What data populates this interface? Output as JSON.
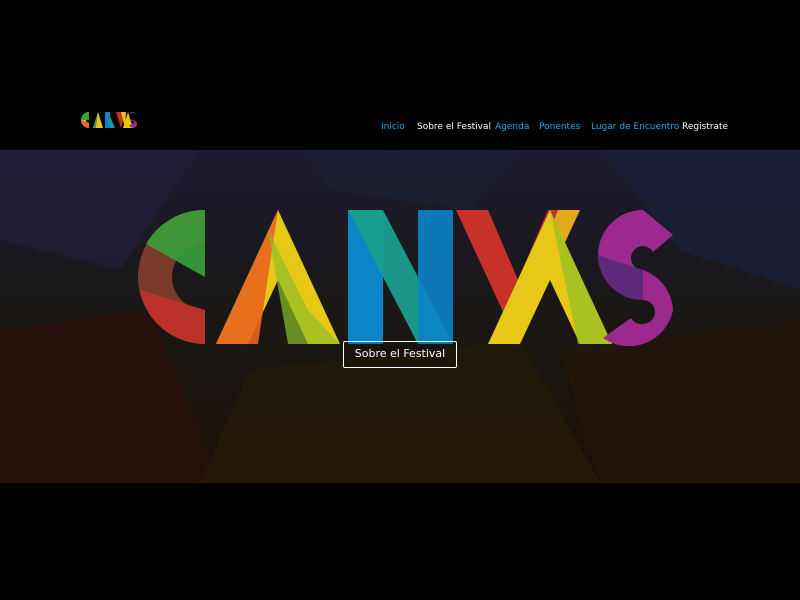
{
  "header": {
    "logo_text": "CANVAS"
  },
  "nav": {
    "items": [
      {
        "label": "Inicio",
        "state": "link"
      },
      {
        "label": "Sobre el Festival",
        "state": "current"
      },
      {
        "label": "Agenda",
        "state": "link"
      },
      {
        "label": "Ponentes",
        "state": "link"
      },
      {
        "label": "Lugar de Encuentro",
        "state": "link"
      },
      {
        "label": "Registrate",
        "state": "current"
      }
    ],
    "link_color": "#29a8ea",
    "current_color": "#ffffff"
  },
  "hero": {
    "logo_text": "CANVAS",
    "button_label": "Sobre el Festival",
    "logo_colors": [
      "#3aa03a",
      "#e8c817",
      "#e8661e",
      "#0b84c8",
      "#1a9e8e",
      "#c8302a",
      "#9c2a8e",
      "#5a2a7a"
    ]
  }
}
